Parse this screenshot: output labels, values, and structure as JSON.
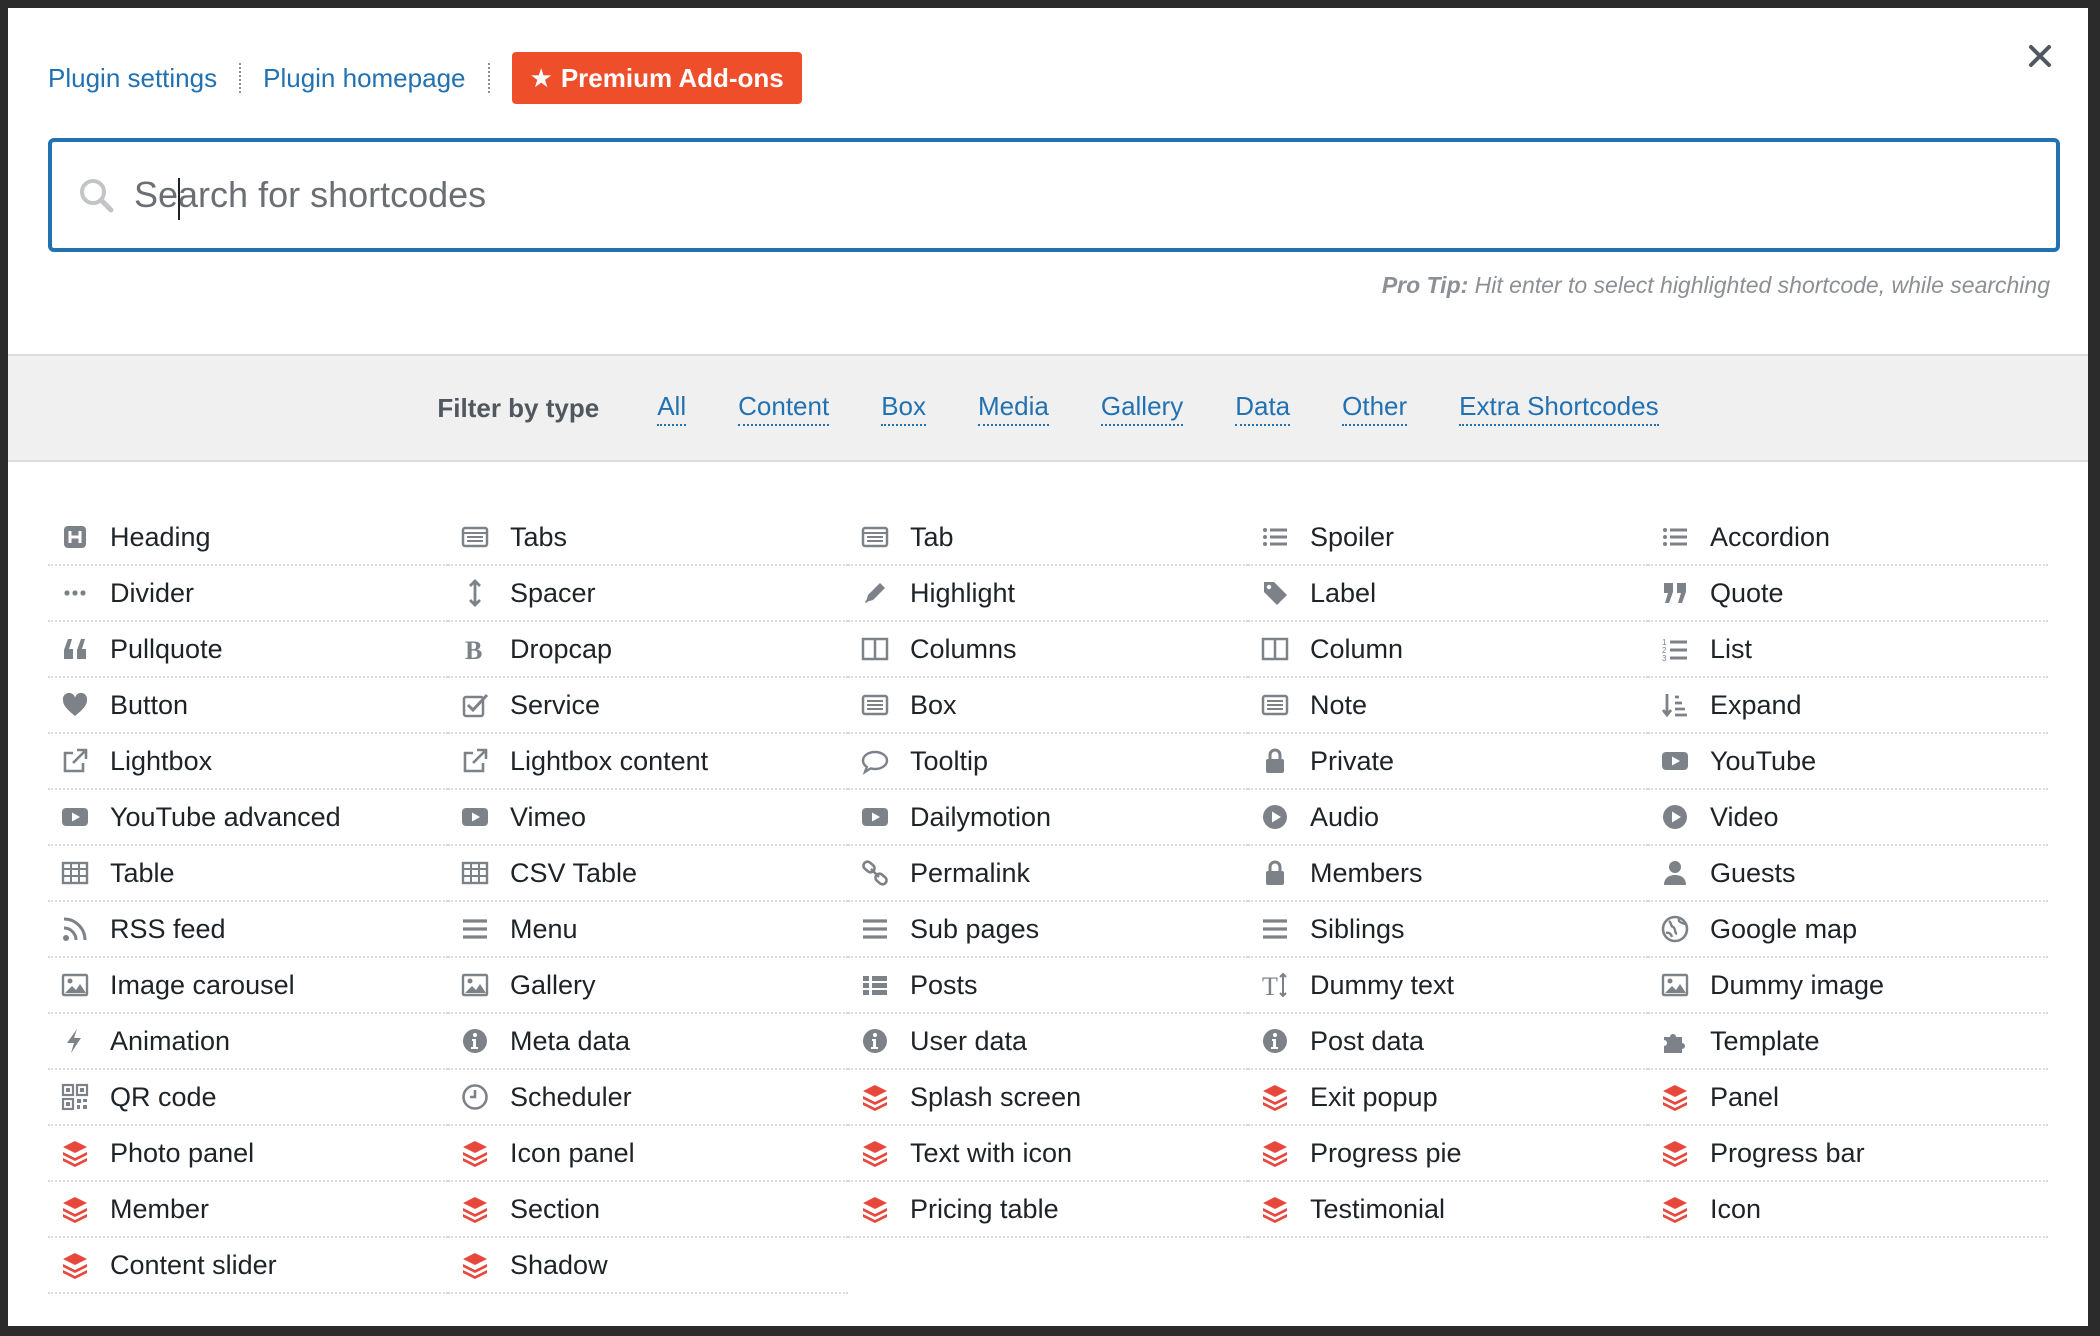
{
  "top_links": {
    "plugin_settings": "Plugin settings",
    "plugin_homepage": "Plugin homepage",
    "premium_addons": "Premium Add-ons"
  },
  "search": {
    "placeholder": "Search for shortcodes",
    "value": ""
  },
  "pro_tip": {
    "label": "Pro Tip:",
    "text": "Hit enter to select highlighted shortcode, while searching"
  },
  "filter": {
    "label": "Filter by type",
    "types": [
      "All",
      "Content",
      "Box",
      "Media",
      "Gallery",
      "Data",
      "Other",
      "Extra Shortcodes"
    ]
  },
  "colors": {
    "accent": "#2271b1",
    "premium": "#ef4e2b",
    "icon": "#7c8288",
    "addon_icon": "#e8473c"
  },
  "shortcodes": [
    {
      "label": "Heading",
      "icon": "heading-icon"
    },
    {
      "label": "Tabs",
      "icon": "tabs-icon"
    },
    {
      "label": "Tab",
      "icon": "tab-icon"
    },
    {
      "label": "Spoiler",
      "icon": "list-icon"
    },
    {
      "label": "Accordion",
      "icon": "list-icon"
    },
    {
      "label": "Divider",
      "icon": "ellipsis-icon"
    },
    {
      "label": "Spacer",
      "icon": "arrows-v-icon"
    },
    {
      "label": "Highlight",
      "icon": "pencil-icon"
    },
    {
      "label": "Label",
      "icon": "tag-icon"
    },
    {
      "label": "Quote",
      "icon": "quote-right-icon"
    },
    {
      "label": "Pullquote",
      "icon": "quote-left-icon"
    },
    {
      "label": "Dropcap",
      "icon": "bold-icon"
    },
    {
      "label": "Columns",
      "icon": "columns-icon"
    },
    {
      "label": "Column",
      "icon": "columns-icon"
    },
    {
      "label": "List",
      "icon": "list-ol-icon"
    },
    {
      "label": "Button",
      "icon": "heart-icon"
    },
    {
      "label": "Service",
      "icon": "check-square-icon"
    },
    {
      "label": "Box",
      "icon": "list-alt-icon"
    },
    {
      "label": "Note",
      "icon": "list-alt-icon"
    },
    {
      "label": "Expand",
      "icon": "sort-amount-icon"
    },
    {
      "label": "Lightbox",
      "icon": "external-link-icon"
    },
    {
      "label": "Lightbox content",
      "icon": "external-link-icon"
    },
    {
      "label": "Tooltip",
      "icon": "comment-icon"
    },
    {
      "label": "Private",
      "icon": "lock-icon"
    },
    {
      "label": "YouTube",
      "icon": "youtube-play-icon"
    },
    {
      "label": "YouTube advanced",
      "icon": "youtube-play-icon"
    },
    {
      "label": "Vimeo",
      "icon": "youtube-play-icon"
    },
    {
      "label": "Dailymotion",
      "icon": "youtube-play-icon"
    },
    {
      "label": "Audio",
      "icon": "play-circle-icon"
    },
    {
      "label": "Video",
      "icon": "play-circle-icon"
    },
    {
      "label": "Table",
      "icon": "table-icon"
    },
    {
      "label": "CSV Table",
      "icon": "table-icon"
    },
    {
      "label": "Permalink",
      "icon": "chain-icon"
    },
    {
      "label": "Members",
      "icon": "lock-icon"
    },
    {
      "label": "Guests",
      "icon": "user-icon"
    },
    {
      "label": "RSS feed",
      "icon": "rss-icon"
    },
    {
      "label": "Menu",
      "icon": "bars-icon"
    },
    {
      "label": "Sub pages",
      "icon": "bars-icon"
    },
    {
      "label": "Siblings",
      "icon": "bars-icon"
    },
    {
      "label": "Google map",
      "icon": "globe-icon"
    },
    {
      "label": "Image carousel",
      "icon": "picture-icon"
    },
    {
      "label": "Gallery",
      "icon": "picture-icon"
    },
    {
      "label": "Posts",
      "icon": "th-list-icon"
    },
    {
      "label": "Dummy text",
      "icon": "text-height-icon"
    },
    {
      "label": "Dummy image",
      "icon": "picture-icon"
    },
    {
      "label": "Animation",
      "icon": "bolt-icon"
    },
    {
      "label": "Meta data",
      "icon": "info-circle-icon"
    },
    {
      "label": "User data",
      "icon": "info-circle-icon"
    },
    {
      "label": "Post data",
      "icon": "info-circle-icon"
    },
    {
      "label": "Template",
      "icon": "puzzle-icon"
    },
    {
      "label": "QR code",
      "icon": "qrcode-icon"
    },
    {
      "label": "Scheduler",
      "icon": "clock-icon"
    },
    {
      "label": "Splash screen",
      "icon": "addon-layers-icon"
    },
    {
      "label": "Exit popup",
      "icon": "addon-layers-icon"
    },
    {
      "label": "Panel",
      "icon": "addon-layers-icon"
    },
    {
      "label": "Photo panel",
      "icon": "addon-layers-icon"
    },
    {
      "label": "Icon panel",
      "icon": "addon-layers-icon"
    },
    {
      "label": "Text with icon",
      "icon": "addon-layers-icon"
    },
    {
      "label": "Progress pie",
      "icon": "addon-layers-icon"
    },
    {
      "label": "Progress bar",
      "icon": "addon-layers-icon"
    },
    {
      "label": "Member",
      "icon": "addon-layers-icon"
    },
    {
      "label": "Section",
      "icon": "addon-layers-icon"
    },
    {
      "label": "Pricing table",
      "icon": "addon-layers-icon"
    },
    {
      "label": "Testimonial",
      "icon": "addon-layers-icon"
    },
    {
      "label": "Icon",
      "icon": "addon-layers-icon"
    },
    {
      "label": "Content slider",
      "icon": "addon-layers-icon"
    },
    {
      "label": "Shadow",
      "icon": "addon-layers-icon"
    }
  ]
}
